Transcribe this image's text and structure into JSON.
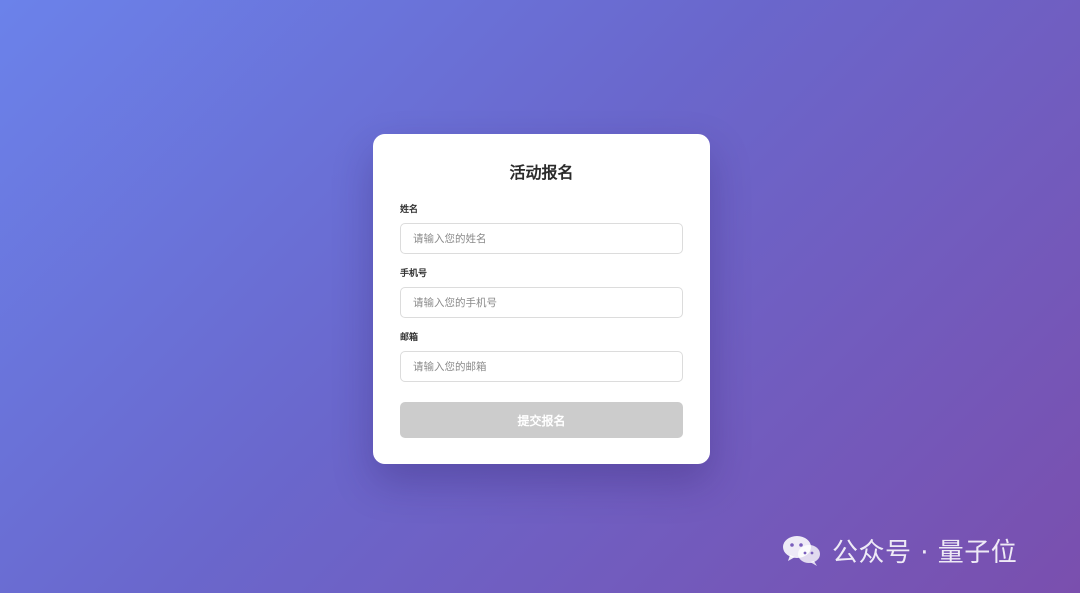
{
  "form": {
    "title": "活动报名",
    "fields": [
      {
        "label": "姓名",
        "placeholder": "请输入您的姓名",
        "value": ""
      },
      {
        "label": "手机号",
        "placeholder": "请输入您的手机号",
        "value": ""
      },
      {
        "label": "邮箱",
        "placeholder": "请输入您的邮箱",
        "value": ""
      }
    ],
    "submit_label": "提交报名"
  },
  "watermark": {
    "text": "公众号 · 量子位",
    "icon": "wechat-icon"
  },
  "colors": {
    "background_start": "#6b82ea",
    "background_end": "#7a4fae",
    "card_background": "#ffffff",
    "button_disabled": "#cccccc",
    "button_text": "#ffffff",
    "input_border": "#dcdcdc"
  }
}
